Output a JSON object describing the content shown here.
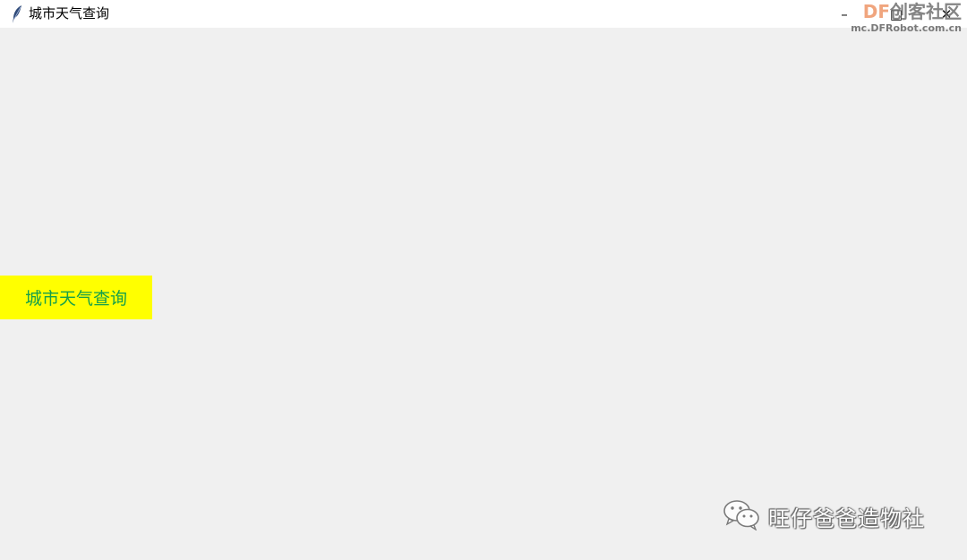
{
  "window": {
    "title": "城市天气查询",
    "icon": "feather-icon",
    "controls": {
      "minimize": "–",
      "maximize": "□",
      "close": "✕"
    }
  },
  "watermark": {
    "brand_prefix": "DF",
    "brand_name": "创客社区",
    "site": "mc.DFRobot.com.cn"
  },
  "main": {
    "query_button_label": "城市天气查询",
    "button_bg": "#ffff00",
    "button_fg": "#16a04a"
  },
  "footer": {
    "wechat_icon": "wechat-icon",
    "account_name": "旺仔爸爸造物社"
  }
}
